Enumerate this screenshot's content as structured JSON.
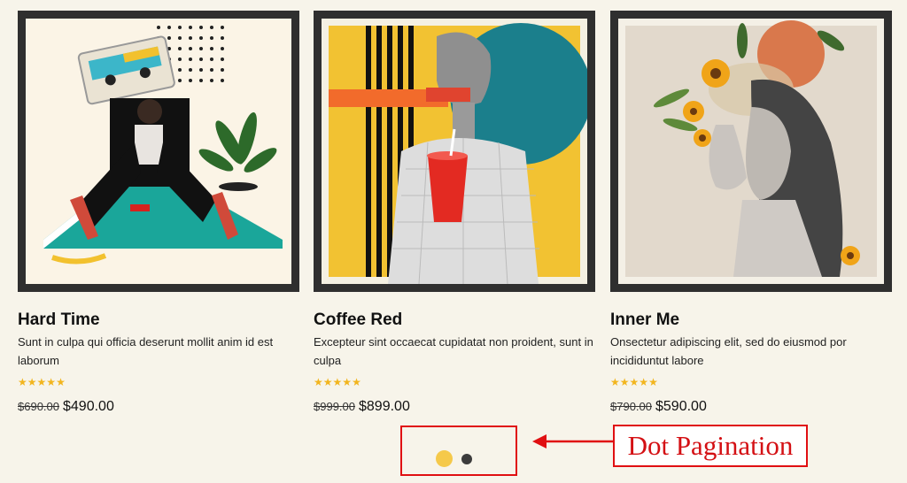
{
  "products": [
    {
      "title": "Hard Time",
      "description": "Sunt in culpa qui officia deserunt mollit anim id est laborum",
      "rating": 5,
      "old_price": "$690.00",
      "price": "$490.00",
      "image_icon": "collage-cassette-woman-plant"
    },
    {
      "title": "Coffee Red",
      "description": "Excepteur sint occaecat cupidatat non proident, sunt in culpa",
      "rating": 5,
      "old_price": "$999.00",
      "price": "$899.00",
      "image_icon": "collage-statue-red-cup"
    },
    {
      "title": "Inner Me",
      "description": "Onsectetur adipiscing elit, sed do eiusmod por incididuntut labore",
      "rating": 5,
      "old_price": "$790.00",
      "price": "$590.00",
      "image_icon": "collage-woman-flowers"
    }
  ],
  "pagination": {
    "dots": 2,
    "active_index": 0,
    "active_color": "#f5c94a",
    "inactive_color": "#3c3c3c"
  },
  "annotation": {
    "label": "Dot Pagination",
    "color": "#e00f12"
  },
  "colors": {
    "background": "#f7f4ea",
    "frame": "#2f2f2f",
    "star": "#f2b51e"
  }
}
